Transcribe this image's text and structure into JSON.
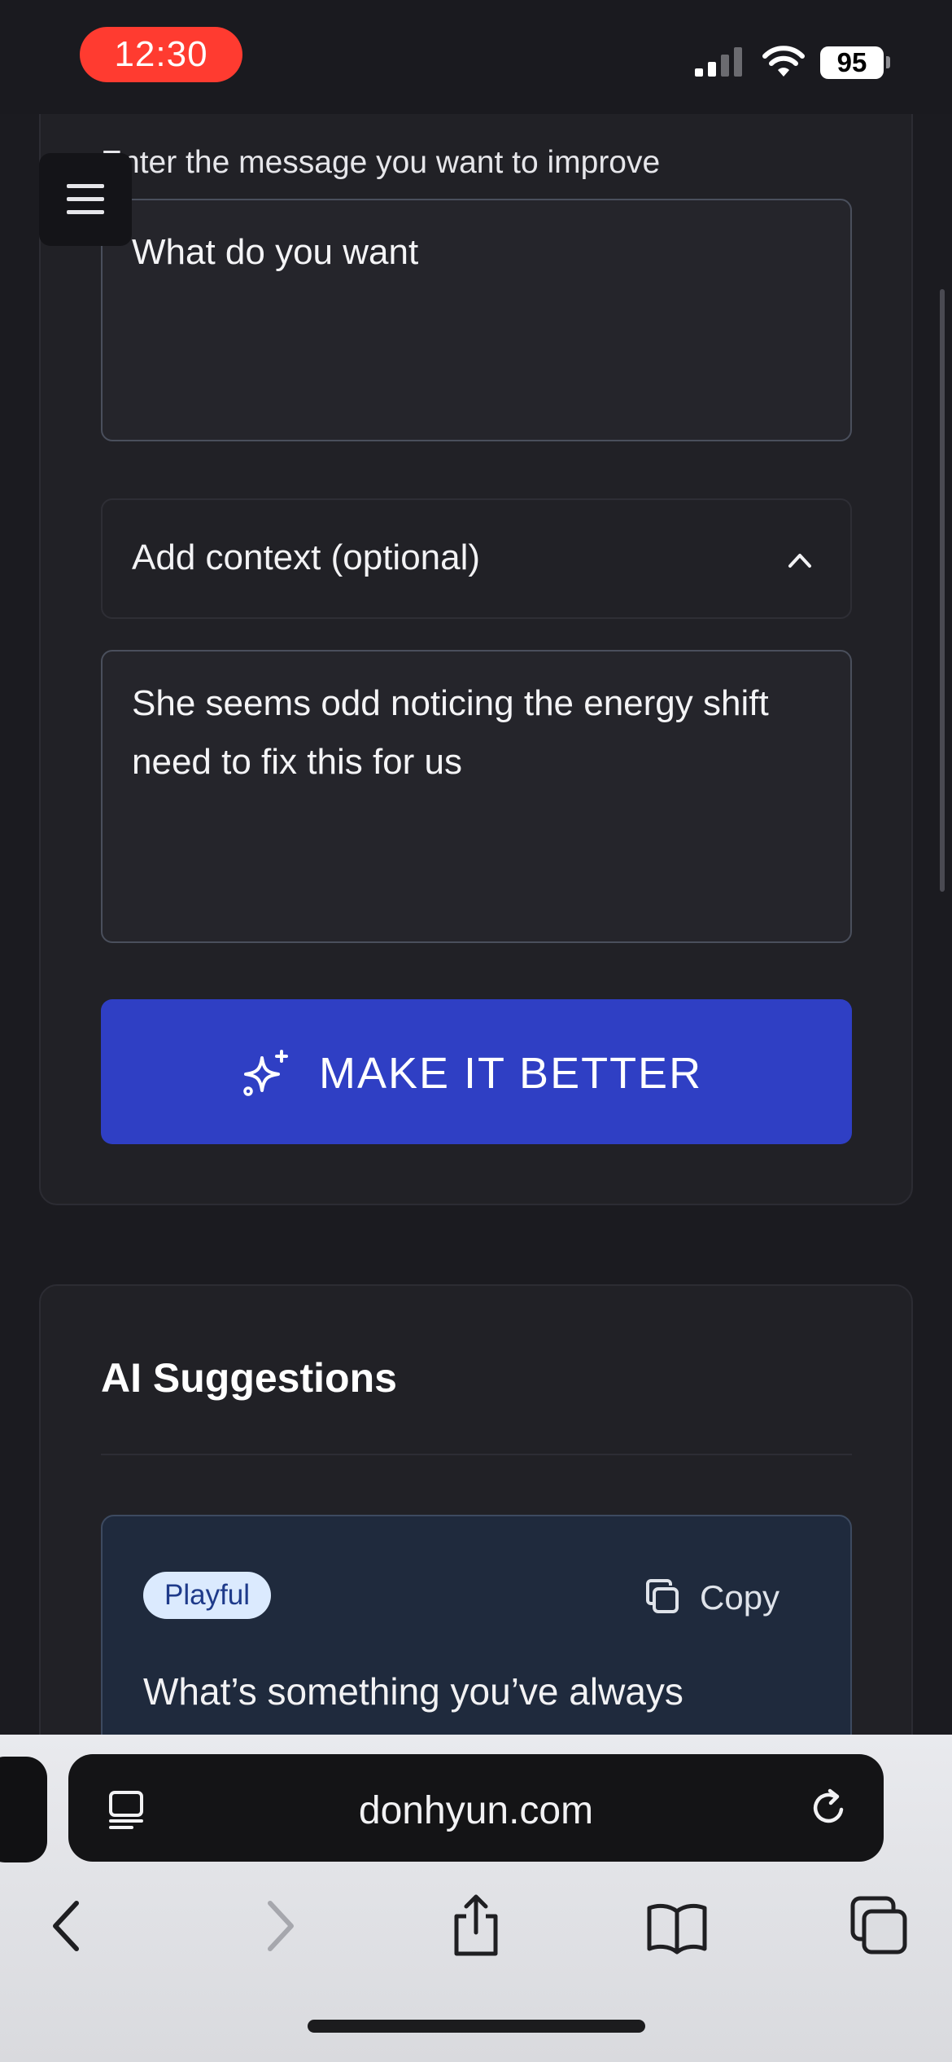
{
  "status_bar": {
    "time": "12:30",
    "battery": "95",
    "icons": [
      "signal-icon",
      "wifi-icon",
      "battery-icon"
    ]
  },
  "form": {
    "message_label": "Enter the message you want to improve",
    "message_value": "What do you want",
    "context_toggle_label": "Add context (optional)",
    "context_value": "She seems odd noticing the energy shift need to fix this for us",
    "submit_label": "MAKE IT BETTER",
    "submit_color": "#2f3fc4"
  },
  "suggestions": {
    "title": "AI Suggestions",
    "items": [
      {
        "tone": "Playful",
        "copy_label": "Copy",
        "text": "What’s something you’ve always"
      }
    ]
  },
  "browser": {
    "url": "donhyun.com",
    "nav_icons": [
      "back-icon",
      "forward-icon",
      "share-icon",
      "bookmarks-icon",
      "tabs-icon"
    ]
  }
}
